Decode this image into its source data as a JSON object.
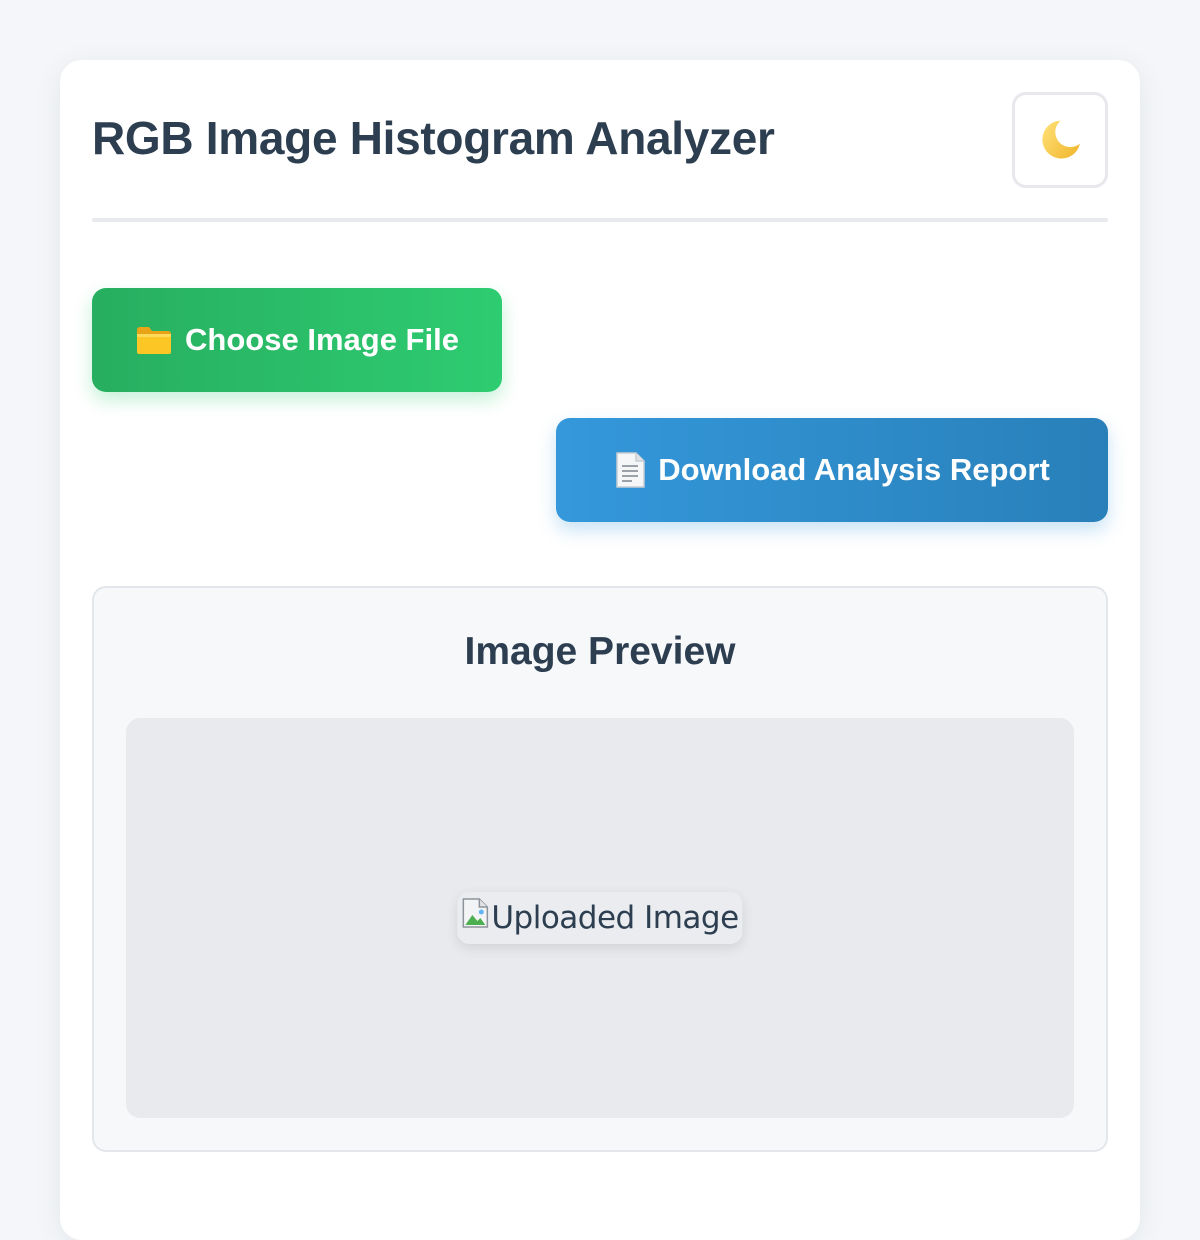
{
  "header": {
    "title": "RGB Image Histogram Analyzer",
    "theme_toggle_icon": "moon-icon"
  },
  "actions": {
    "choose_file": {
      "icon": "folder-icon",
      "label": "Choose Image File",
      "color_start": "#27ae60",
      "color_end": "#2ecc71"
    },
    "download_report": {
      "icon": "document-icon",
      "label": "Download Analysis Report",
      "color_start": "#3498db",
      "color_end": "#2980b9"
    }
  },
  "preview": {
    "title": "Image Preview",
    "image_alt": "Uploaded Image",
    "broken_image_icon": "broken-image-icon"
  },
  "colors": {
    "text_primary": "#2c3e50",
    "page_background": "#f4f6f9",
    "preview_background": "#e8eaed"
  }
}
